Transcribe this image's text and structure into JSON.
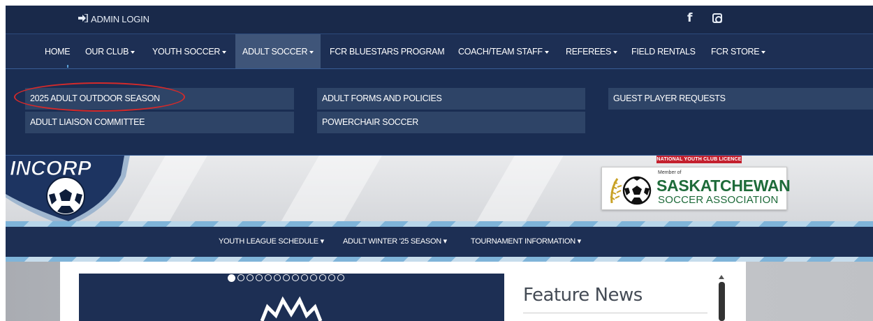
{
  "topbar": {
    "admin_login_label": "ADMIN LOGIN",
    "admin_icon": "sign-in-icon",
    "facebook_icon": "facebook-icon",
    "instagram_icon": "instagram-icon",
    "facebook_glyph": "f"
  },
  "mainnav": {
    "items": [
      {
        "label": "HOME",
        "caret": false
      },
      {
        "label": "OUR CLUB",
        "caret": true
      },
      {
        "label": "YOUTH SOCCER",
        "caret": true
      },
      {
        "label": "ADULT SOCCER",
        "caret": true,
        "active": true
      },
      {
        "label": "FCR BLUESTARS PROGRAM",
        "caret": false
      },
      {
        "label": "COACH/TEAM STAFF",
        "caret": true
      },
      {
        "label": "REFEREES",
        "caret": true
      },
      {
        "label": "FIELD RENTALS",
        "caret": false
      },
      {
        "label": "FCR STORE",
        "caret": true
      }
    ]
  },
  "dropdown": {
    "items": [
      {
        "label": "2025 ADULT OUTDOOR SEASON"
      },
      {
        "label": "ADULT LIAISON COMMITTEE"
      },
      {
        "label": "ADULT FORMS AND POLICIES"
      },
      {
        "label": "POWERCHAIR SOCCER"
      },
      {
        "label": "GUEST PLAYER REQUESTS"
      }
    ]
  },
  "banner": {
    "licence_tag": "NATIONAL YOUTH CLUB LICENCE",
    "ssa_member": "Member of",
    "ssa_line1": "SASKATCHEWAN",
    "ssa_line2": "SOCCER ASSOCIATION"
  },
  "subnav": {
    "items": [
      {
        "label": "YOUTH LEAGUE SCHEDULE ▾"
      },
      {
        "label": "ADULT WINTER '25 SEASON ▾"
      },
      {
        "label": "TOURNAMENT INFORMATION ▾"
      }
    ]
  },
  "slider": {
    "dot_count": 13,
    "active_dot": 1
  },
  "feature": {
    "title": "Feature News"
  },
  "colors": {
    "nav_bg": "#1d2f54",
    "active_bg": "#3f5579",
    "highlight": "#d42a2a",
    "ssa_green": "#1e6b3a"
  }
}
